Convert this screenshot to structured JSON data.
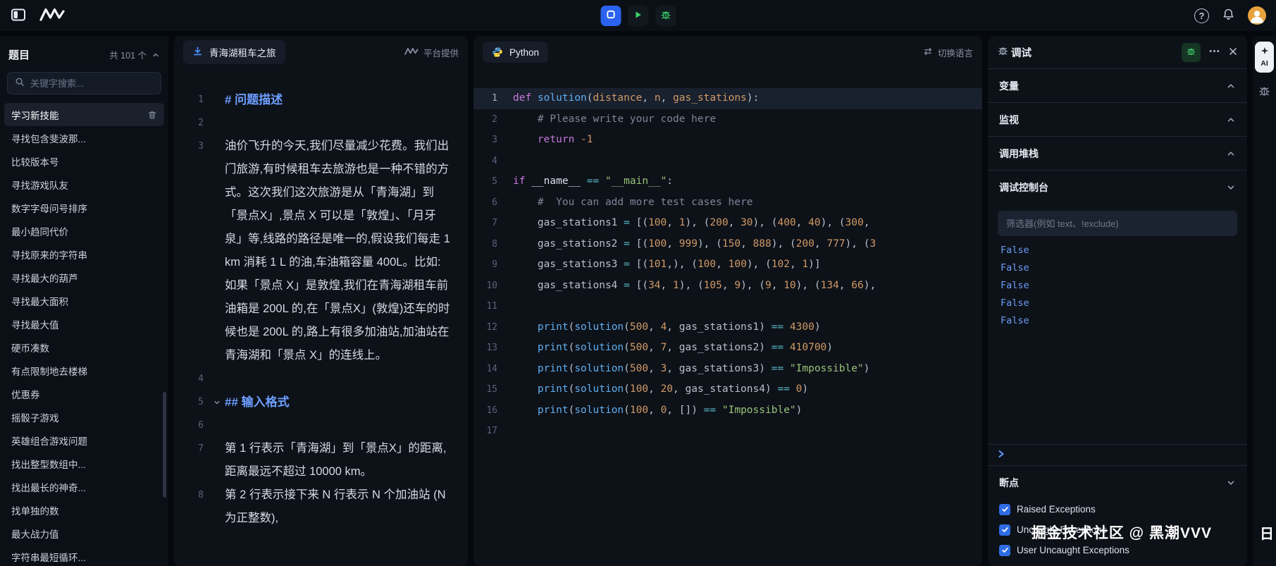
{
  "topbar": {
    "help": "?"
  },
  "sidebar": {
    "title": "题目",
    "count": "共 101 个",
    "search_placeholder": "关键字搜索...",
    "items": [
      {
        "label": "学习新技能",
        "active": true
      },
      {
        "label": "寻找包含斐波那..."
      },
      {
        "label": "比较版本号"
      },
      {
        "label": "寻找游戏队友"
      },
      {
        "label": "数字字母问号排序"
      },
      {
        "label": "最小趋同代价"
      },
      {
        "label": "寻找原来的字符串"
      },
      {
        "label": "寻找最大的葫芦"
      },
      {
        "label": "寻找最大面积"
      },
      {
        "label": "寻找最大值"
      },
      {
        "label": "硬币凑数"
      },
      {
        "label": "有点限制地去楼梯"
      },
      {
        "label": "优惠券"
      },
      {
        "label": "摇骰子游戏"
      },
      {
        "label": "英雄组合游戏问题"
      },
      {
        "label": "找出整型数组中..."
      },
      {
        "label": "找出最长的神奇..."
      },
      {
        "label": "找单独的数"
      },
      {
        "label": "最大战力值"
      },
      {
        "label": "字符串最短循环..."
      }
    ]
  },
  "problem": {
    "title": "青海湖租车之旅",
    "source": "平台提供",
    "lines": [
      {
        "n": 1,
        "type": "h1",
        "text": "# 问题描述"
      },
      {
        "n": 2,
        "type": "empty"
      },
      {
        "n": 3,
        "type": "p",
        "text": "油价飞升的今天,我们尽量减少花费。我们出门旅游,有时候租车去旅游也是一种不错的方式。这次我们这次旅游是从「青海湖」到「景点X」,景点 X 可以是「敦煌」、「月牙泉」等,线路的路径是唯一的,假设我们每走 1 km 消耗 1 L 的油,车油箱容量 400L。比如:如果「景点 X」是敦煌,我们在青海湖租车前油箱是 200L 的,在「景点X」(敦煌)还车的时候也是 200L 的,路上有很多加油站,加油站在青海湖和「景点 X」的连线上。"
      },
      {
        "n": 4,
        "type": "empty"
      },
      {
        "n": 5,
        "type": "h2",
        "text": "## 输入格式",
        "fold": true
      },
      {
        "n": 6,
        "type": "empty"
      },
      {
        "n": 7,
        "type": "p",
        "text": "第 1 行表示「青海湖」到「景点X」的距离,距离最远不超过 10000 km。"
      },
      {
        "n": 8,
        "type": "p",
        "text": "第 2 行表示接下来 N 行表示 N 个加油站 (N 为正整数),"
      }
    ]
  },
  "editor": {
    "language": "Python",
    "switch_label": "切换语言",
    "lines": [
      {
        "active": true,
        "tokens": [
          [
            "kw",
            "def"
          ],
          [
            "txt",
            " "
          ],
          [
            "fn",
            "solution"
          ],
          [
            "txt",
            "("
          ],
          [
            "par",
            "distance"
          ],
          [
            "txt",
            ", "
          ],
          [
            "par",
            "n"
          ],
          [
            "txt",
            ", "
          ],
          [
            "par",
            "gas_stations"
          ],
          [
            "txt",
            "):"
          ]
        ]
      },
      {
        "tokens": [
          [
            "txt",
            "    "
          ],
          [
            "com",
            "# Please write your code here"
          ]
        ]
      },
      {
        "tokens": [
          [
            "txt",
            "    "
          ],
          [
            "kw",
            "return"
          ],
          [
            "txt",
            " "
          ],
          [
            "num",
            "-1"
          ]
        ]
      },
      {
        "tokens": []
      },
      {
        "tokens": [
          [
            "kw",
            "if"
          ],
          [
            "txt",
            " "
          ],
          [
            "var",
            "__name__"
          ],
          [
            "txt",
            " "
          ],
          [
            "op",
            "=="
          ],
          [
            "txt",
            " "
          ],
          [
            "str",
            "\"__main__\""
          ],
          [
            "txt",
            ":"
          ]
        ]
      },
      {
        "tokens": [
          [
            "txt",
            "    "
          ],
          [
            "com",
            "#  You can add more test cases here"
          ]
        ]
      },
      {
        "tokens": [
          [
            "txt",
            "    gas_stations1 "
          ],
          [
            "op",
            "="
          ],
          [
            "txt",
            " [("
          ],
          [
            "num",
            "100"
          ],
          [
            "txt",
            ", "
          ],
          [
            "num",
            "1"
          ],
          [
            "txt",
            "), ("
          ],
          [
            "num",
            "200"
          ],
          [
            "txt",
            ", "
          ],
          [
            "num",
            "30"
          ],
          [
            "txt",
            "), ("
          ],
          [
            "num",
            "400"
          ],
          [
            "txt",
            ", "
          ],
          [
            "num",
            "40"
          ],
          [
            "txt",
            "), ("
          ],
          [
            "num",
            "300"
          ],
          [
            "txt",
            ","
          ]
        ]
      },
      {
        "tokens": [
          [
            "txt",
            "    gas_stations2 "
          ],
          [
            "op",
            "="
          ],
          [
            "txt",
            " [("
          ],
          [
            "num",
            "100"
          ],
          [
            "txt",
            ", "
          ],
          [
            "num",
            "999"
          ],
          [
            "txt",
            "), ("
          ],
          [
            "num",
            "150"
          ],
          [
            "txt",
            ", "
          ],
          [
            "num",
            "888"
          ],
          [
            "txt",
            "), ("
          ],
          [
            "num",
            "200"
          ],
          [
            "txt",
            ", "
          ],
          [
            "num",
            "777"
          ],
          [
            "txt",
            "), ("
          ],
          [
            "num",
            "3"
          ]
        ]
      },
      {
        "tokens": [
          [
            "txt",
            "    gas_stations3 "
          ],
          [
            "op",
            "="
          ],
          [
            "txt",
            " [("
          ],
          [
            "num",
            "101"
          ],
          [
            "txt",
            ",), ("
          ],
          [
            "num",
            "100"
          ],
          [
            "txt",
            ", "
          ],
          [
            "num",
            "100"
          ],
          [
            "txt",
            "), ("
          ],
          [
            "num",
            "102"
          ],
          [
            "txt",
            ", "
          ],
          [
            "num",
            "1"
          ],
          [
            "txt",
            ")]"
          ]
        ]
      },
      {
        "tokens": [
          [
            "txt",
            "    gas_stations4 "
          ],
          [
            "op",
            "="
          ],
          [
            "txt",
            " [("
          ],
          [
            "num",
            "34"
          ],
          [
            "txt",
            ", "
          ],
          [
            "num",
            "1"
          ],
          [
            "txt",
            "), ("
          ],
          [
            "num",
            "105"
          ],
          [
            "txt",
            ", "
          ],
          [
            "num",
            "9"
          ],
          [
            "txt",
            "), ("
          ],
          [
            "num",
            "9"
          ],
          [
            "txt",
            ", "
          ],
          [
            "num",
            "10"
          ],
          [
            "txt",
            "), ("
          ],
          [
            "num",
            "134"
          ],
          [
            "txt",
            ", "
          ],
          [
            "num",
            "66"
          ],
          [
            "txt",
            "),"
          ]
        ]
      },
      {
        "tokens": []
      },
      {
        "tokens": [
          [
            "txt",
            "    "
          ],
          [
            "fn",
            "print"
          ],
          [
            "txt",
            "("
          ],
          [
            "fn",
            "solution"
          ],
          [
            "txt",
            "("
          ],
          [
            "num",
            "500"
          ],
          [
            "txt",
            ", "
          ],
          [
            "num",
            "4"
          ],
          [
            "txt",
            ", gas_stations1) "
          ],
          [
            "op",
            "=="
          ],
          [
            "txt",
            " "
          ],
          [
            "num",
            "4300"
          ],
          [
            "txt",
            ")"
          ]
        ]
      },
      {
        "tokens": [
          [
            "txt",
            "    "
          ],
          [
            "fn",
            "print"
          ],
          [
            "txt",
            "("
          ],
          [
            "fn",
            "solution"
          ],
          [
            "txt",
            "("
          ],
          [
            "num",
            "500"
          ],
          [
            "txt",
            ", "
          ],
          [
            "num",
            "7"
          ],
          [
            "txt",
            ", gas_stations2) "
          ],
          [
            "op",
            "=="
          ],
          [
            "txt",
            " "
          ],
          [
            "num",
            "410700"
          ],
          [
            "txt",
            ")"
          ]
        ]
      },
      {
        "tokens": [
          [
            "txt",
            "    "
          ],
          [
            "fn",
            "print"
          ],
          [
            "txt",
            "("
          ],
          [
            "fn",
            "solution"
          ],
          [
            "txt",
            "("
          ],
          [
            "num",
            "500"
          ],
          [
            "txt",
            ", "
          ],
          [
            "num",
            "3"
          ],
          [
            "txt",
            ", gas_stations3) "
          ],
          [
            "op",
            "=="
          ],
          [
            "txt",
            " "
          ],
          [
            "str",
            "\"Impossible\""
          ],
          [
            "txt",
            ")"
          ]
        ]
      },
      {
        "tokens": [
          [
            "txt",
            "    "
          ],
          [
            "fn",
            "print"
          ],
          [
            "txt",
            "("
          ],
          [
            "fn",
            "solution"
          ],
          [
            "txt",
            "("
          ],
          [
            "num",
            "100"
          ],
          [
            "txt",
            ", "
          ],
          [
            "num",
            "20"
          ],
          [
            "txt",
            ", gas_stations4) "
          ],
          [
            "op",
            "=="
          ],
          [
            "txt",
            " "
          ],
          [
            "num",
            "0"
          ],
          [
            "txt",
            ")"
          ]
        ]
      },
      {
        "tokens": [
          [
            "txt",
            "    "
          ],
          [
            "fn",
            "print"
          ],
          [
            "txt",
            "("
          ],
          [
            "fn",
            "solution"
          ],
          [
            "txt",
            "("
          ],
          [
            "num",
            "100"
          ],
          [
            "txt",
            ", "
          ],
          [
            "num",
            "0"
          ],
          [
            "txt",
            ", []) "
          ],
          [
            "op",
            "=="
          ],
          [
            "txt",
            " "
          ],
          [
            "str",
            "\"Impossible\""
          ],
          [
            "txt",
            ")"
          ]
        ]
      },
      {
        "tokens": []
      }
    ]
  },
  "debug": {
    "title": "调试",
    "sections": [
      {
        "id": "variables",
        "label": "变量",
        "state": "up"
      },
      {
        "id": "watch",
        "label": "监视",
        "state": "up"
      },
      {
        "id": "call-stack",
        "label": "调用堆栈",
        "state": "up"
      },
      {
        "id": "debug-console",
        "label": "调试控制台",
        "state": "down"
      }
    ],
    "filter_placeholder": "筛选器(例如 text、!exclude)",
    "console_values": [
      "False",
      "False",
      "False",
      "False",
      "False"
    ],
    "breakpoints": {
      "label": "断点",
      "items": [
        {
          "label": "Raised Exceptions",
          "checked": true
        },
        {
          "label": "Uncaught Exceptions",
          "checked": true
        },
        {
          "label": "User Uncaught Exceptions",
          "checked": true
        }
      ]
    }
  },
  "right_rail": {
    "ai_label": "AI"
  },
  "watermark": {
    "text": "掘金技术社区 @ 黑潮VVV",
    "edge": "日"
  }
}
